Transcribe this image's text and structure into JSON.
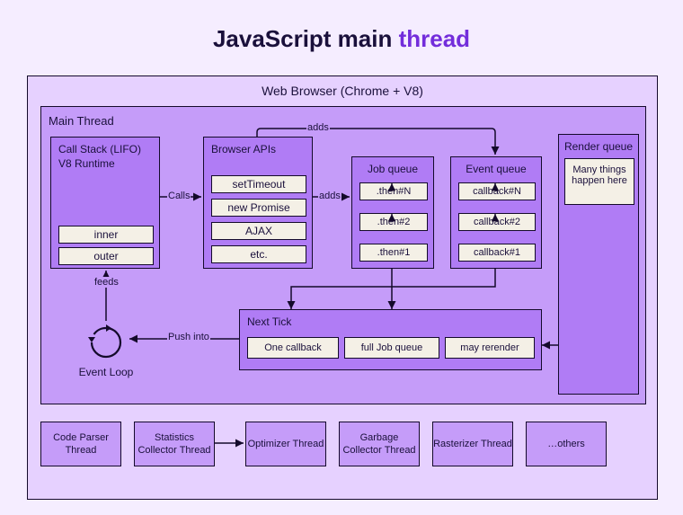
{
  "title": {
    "part1": "JavaScript main ",
    "part2": "thread"
  },
  "browser": {
    "title": "Web Browser (Chrome + V8)"
  },
  "mainThread": {
    "label": "Main Thread"
  },
  "renderQueue": {
    "label": "Render queue",
    "text": "Many things happen here"
  },
  "callStack": {
    "label1": "Call Stack (LIFO)",
    "label2": "V8 Runtime",
    "inner": "inner",
    "outer": "outer"
  },
  "browserApis": {
    "label": "Browser APIs",
    "items": [
      "setTimeout",
      "new Promise",
      "AJAX",
      "etc."
    ]
  },
  "jobQueue": {
    "label": "Job queue",
    "items": [
      ".then#N",
      ".then#2",
      ".then#1"
    ]
  },
  "eventQueue": {
    "label": "Event queue",
    "items": [
      "callback#N",
      "callback#2",
      "callback#1"
    ]
  },
  "nextTick": {
    "label": "Next Tick",
    "items": [
      "One callback",
      "full Job queue",
      "may rerender"
    ]
  },
  "labels": {
    "calls": "Calls",
    "adds1": "adds",
    "adds2": "adds",
    "feeds": "feeds",
    "pushInto": "Push into",
    "eventLoop": "Event Loop"
  },
  "bottomThreads": [
    "Code Parser Thread",
    "Statistics Collector Thread",
    "Optimizer Thread",
    "Garbage Collector Thread",
    "Rasterizer Thread",
    "…others"
  ]
}
